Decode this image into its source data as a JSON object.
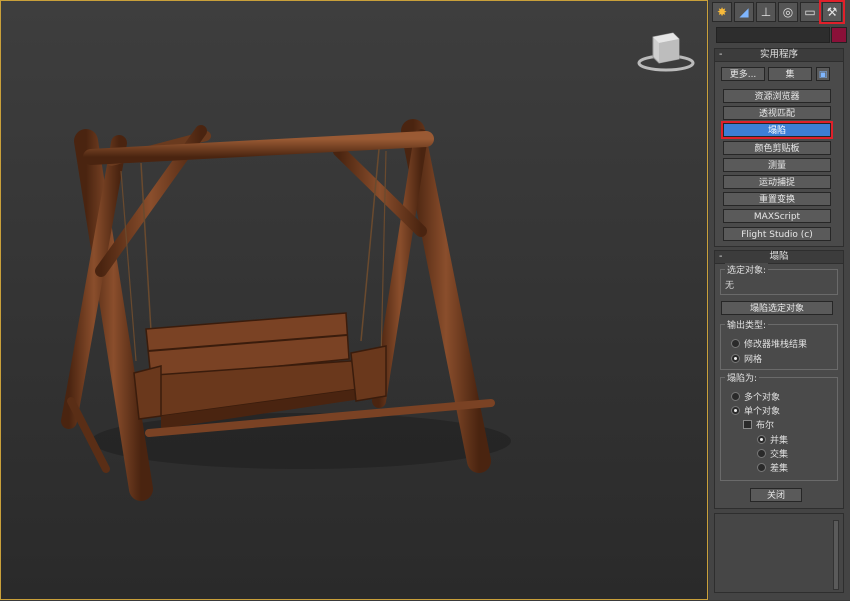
{
  "viewport": {
    "name": "perspective-viewport"
  },
  "tabs": [
    {
      "icon": "create-icon"
    },
    {
      "icon": "modify-icon"
    },
    {
      "icon": "hierarchy-icon"
    },
    {
      "icon": "motion-icon"
    },
    {
      "icon": "display-icon"
    },
    {
      "icon": "utilities-hammer-icon",
      "active": true
    }
  ],
  "utilities": {
    "title": "实用程序",
    "more_label": "更多...",
    "sets_label": "集",
    "items": [
      "资源浏览器",
      "透视匹配",
      "塌陷",
      "颜色剪贴板",
      "测量",
      "运动捕捉",
      "重置变换",
      "MAXScript",
      "Flight Studio (c)"
    ],
    "active_index": 2
  },
  "collapse": {
    "title": "塌陷",
    "selected_label": "选定对象:",
    "selected_value": "无",
    "collapse_button": "塌陷选定对象",
    "output_type": {
      "title": "输出类型:",
      "options": [
        "修改器堆栈结果",
        "网格"
      ],
      "selected": 1
    },
    "collapse_to": {
      "title": "塌陷为:",
      "options": [
        "多个对象",
        "单个对象"
      ],
      "selected": 1,
      "boolean_label": "布尔",
      "boolean_options": [
        "并集",
        "交集",
        "差集"
      ],
      "boolean_selected": 0
    },
    "close_label": "关闭"
  },
  "colors": {
    "active_button": "#3d7fd6",
    "highlight_box": "#e0202a",
    "wood": "#7a4526"
  }
}
